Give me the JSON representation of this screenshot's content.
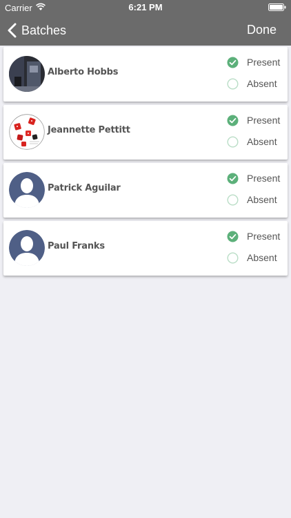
{
  "status_bar": {
    "carrier": "Carrier",
    "time": "6:21 PM"
  },
  "nav": {
    "back_label": "Batches",
    "done_label": "Done"
  },
  "students": [
    {
      "name": "Alberto  Hobbs",
      "avatar": "photo-avatar",
      "present_label": "Present",
      "absent_label": "Absent",
      "status": "present"
    },
    {
      "name": "Jeannette Pettitt",
      "avatar": "dice-avatar",
      "present_label": "Present",
      "absent_label": "Absent",
      "status": "present"
    },
    {
      "name": "Patrick Aguilar",
      "avatar": "default-avatar",
      "present_label": "Present",
      "absent_label": "Absent",
      "status": "present"
    },
    {
      "name": "Paul Franks",
      "avatar": "default-avatar",
      "present_label": "Present",
      "absent_label": "Absent",
      "status": "present"
    }
  ],
  "colors": {
    "header": "#6b6b6b",
    "background": "#efeff4",
    "check_green": "#5cb07a",
    "radio_unselected": "#b9ddc6",
    "default_avatar_bg": "#4f5f86"
  }
}
